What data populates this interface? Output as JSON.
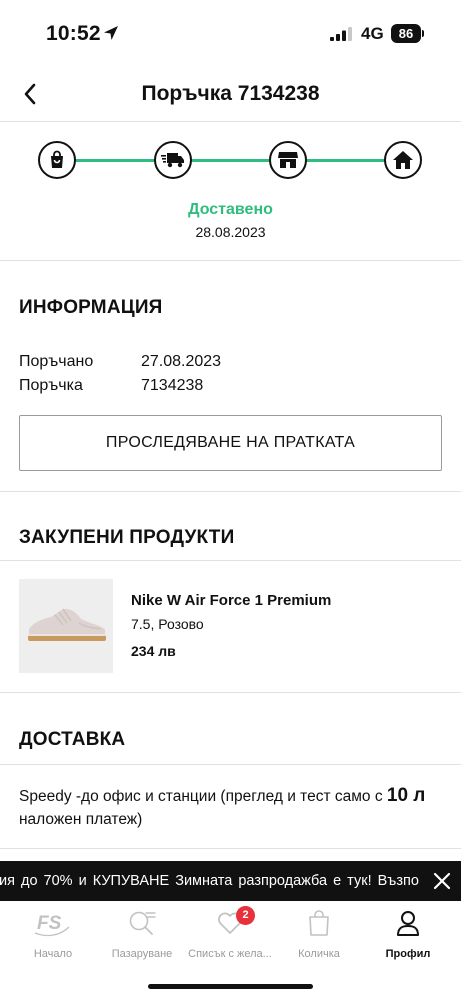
{
  "status_bar": {
    "time": "10:52",
    "network": "4G",
    "battery": "86"
  },
  "header": {
    "title": "Поръчка 7134238"
  },
  "tracker": {
    "steps": [
      "shopping-bag-icon",
      "delivery-truck-icon",
      "store-icon",
      "home-icon"
    ],
    "progress": 1.0,
    "status": "Доставено",
    "date": "28.08.2023",
    "accent_color": "#2ebd7e"
  },
  "info": {
    "title": "ИНФОРМАЦИЯ",
    "ordered_label": "Поръчано",
    "ordered_value": "27.08.2023",
    "order_label": "Поръчка",
    "order_value": "7134238",
    "track_button": "ПРОСЛЕДЯВАНЕ НА ПРАТКАТА"
  },
  "products": {
    "title": "ЗАКУПЕНИ ПРОДУКТИ",
    "items": [
      {
        "name": "Nike W Air Force 1 Premium",
        "variant": "7.5, Розово",
        "price": "234 лв"
      }
    ]
  },
  "delivery": {
    "title": "ДОСТАВКА",
    "text_line1": "Speedy -до офис и станции (преглед и тест само с ",
    "text_bold": "10 л",
    "text_line2": "наложен платеж)"
  },
  "promo": {
    "text": "ия до 70% и КУПУВАНЕ    Зимната разпродажба е тук! Възпо"
  },
  "tab_bar": {
    "tabs": [
      {
        "label": "Начало",
        "icon": "fs-logo-icon",
        "active": false
      },
      {
        "label": "Пазаруване",
        "icon": "search-icon",
        "active": false
      },
      {
        "label": "Списък с жела...",
        "icon": "heart-icon",
        "active": false,
        "badge": "2"
      },
      {
        "label": "Количка",
        "icon": "shopping-bag-icon",
        "active": false
      },
      {
        "label": "Профил",
        "icon": "user-icon",
        "active": true
      }
    ],
    "badge_color": "#e8313a"
  }
}
